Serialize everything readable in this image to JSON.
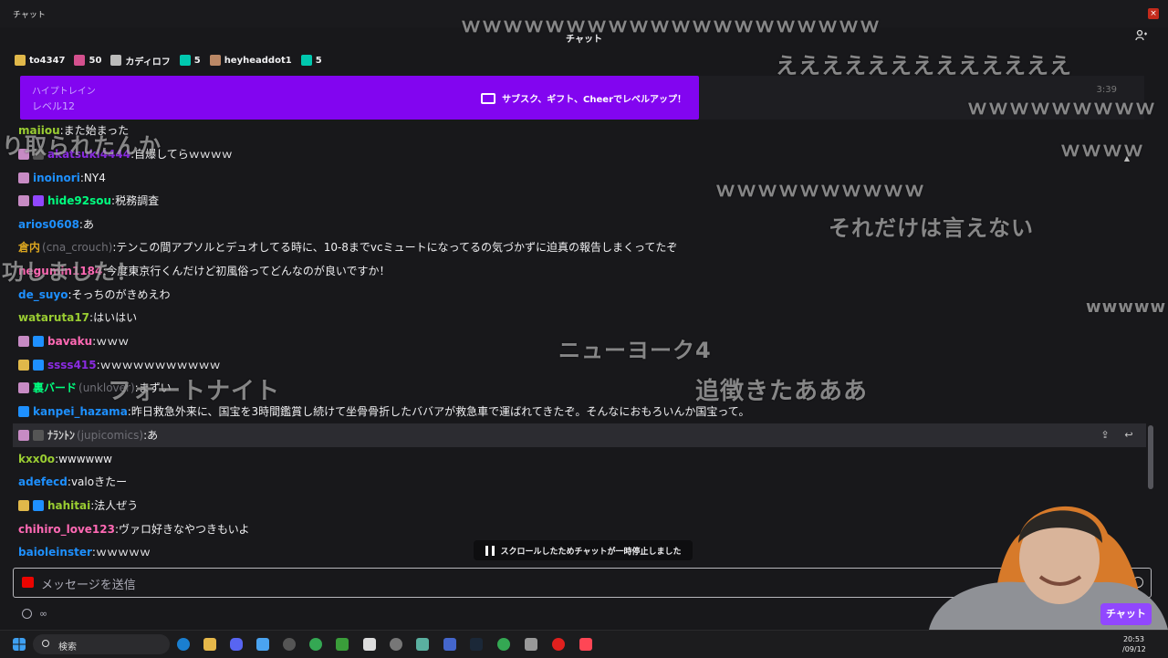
{
  "window": {
    "title": "チャット",
    "close": "×"
  },
  "header": {
    "title": "チャット"
  },
  "leaderboard": [
    {
      "name": "to4347",
      "color": "#e0b84a"
    },
    {
      "name": "50",
      "color": "#d4508e"
    },
    {
      "name": "カディロフ",
      "color": "#bbbbbb"
    },
    {
      "name": "5",
      "color": "#00c8af"
    },
    {
      "name": "heyheaddot1",
      "color": "#bb8866"
    },
    {
      "name": "5",
      "color": "#00c8af"
    }
  ],
  "hype_train": {
    "label": "ハイプトレイン",
    "level": "レベル12",
    "cta": "サブスク、ギフト、Cheerでレベルアップ！",
    "time": "3:39"
  },
  "messages": [
    {
      "user": "maiiou",
      "alias": "",
      "text": "また始まった",
      "color": "#9acd32",
      "badges": []
    },
    {
      "user": "akatsuki4444",
      "alias": "",
      "text": "自爆してらｗｗｗｗ",
      "color": "#8a2be2",
      "badges": [
        "#c78bc4",
        "#555555"
      ]
    },
    {
      "user": "inoinori",
      "alias": "",
      "text": "NY4",
      "color": "#1e90ff",
      "badges": [
        "#c78bc4"
      ]
    },
    {
      "user": "hide92sou",
      "alias": "",
      "text": "税務調査",
      "color": "#00ff7f",
      "badges": [
        "#c78bc4",
        "#9147ff"
      ]
    },
    {
      "user": "arios0608",
      "alias": "",
      "text": "あ",
      "color": "#1e90ff",
      "badges": []
    },
    {
      "user": "倉内",
      "alias": "(cna_crouch)",
      "text": "テンこの間アプソルとデュオしてる時に、10-8までvcミュートになってるの気づかずに迫真の報告しまくってたぞ",
      "color": "#daa520",
      "badges": []
    },
    {
      "user": "negumin1184",
      "alias": "",
      "text": "今度東京行くんだけど初風俗ってどんなのが良いですか！",
      "color": "#ff69b4",
      "badges": []
    },
    {
      "user": "de_suyo",
      "alias": "",
      "text": "そっちのがきめえわ",
      "color": "#1e90ff",
      "badges": []
    },
    {
      "user": "wataruta17",
      "alias": "",
      "text": "はいはい",
      "color": "#9acd32",
      "badges": []
    },
    {
      "user": "bavaku",
      "alias": "",
      "text": "ｗｗｗ",
      "color": "#ff69b4",
      "badges": [
        "#c78bc4",
        "#1e90ff"
      ]
    },
    {
      "user": "ssss415",
      "alias": "",
      "text": "ｗｗｗｗｗｗｗｗｗｗｗ",
      "color": "#8a2be2",
      "badges": [
        "#e0b84a",
        "#1e90ff"
      ]
    },
    {
      "user": "裏バード",
      "alias": "(unklover)",
      "text": "まずい",
      "color": "#00ff7f",
      "badges": [
        "#c78bc4"
      ]
    },
    {
      "user": "kanpei_hazama",
      "alias": "",
      "text": "昨日救急外来に、国宝を3時間鑑賞し続けて坐骨骨折したババアが救急車で運ばれてきたぞ。そんなにおもろいんか国宝って。",
      "color": "#1e90ff",
      "badges": [
        "#1e90ff"
      ]
    },
    {
      "user": "ﾅﾗﾝﾄﾝ",
      "alias": "(jupicomics)",
      "text": "あ",
      "color": "#cccccc",
      "badges": [
        "#c78bc4",
        "#555555"
      ]
    },
    {
      "user": "kxx0o",
      "alias": "",
      "text": "wwwwww",
      "color": "#9acd32",
      "badges": []
    },
    {
      "user": "adefecd",
      "alias": "",
      "text": "valoきたー",
      "color": "#1e90ff",
      "badges": []
    },
    {
      "user": "hahitai",
      "alias": "",
      "text": "法人ぜう",
      "color": "#9acd32",
      "badges": [
        "#e0b84a",
        "#1e90ff"
      ]
    },
    {
      "user": "chihiro_love123",
      "alias": "",
      "text": "ヴァロ好きなやつきもいよ",
      "color": "#ff69b4",
      "badges": []
    },
    {
      "user": "baioleinster",
      "alias": "",
      "text": "ｗｗｗｗｗ",
      "color": "#1e90ff",
      "badges": []
    }
  ],
  "pause_notice": "スクロールしたためチャットが一時停止しました",
  "input": {
    "placeholder": "メッセージを送信"
  },
  "points": "∞",
  "chat_button": "チャット",
  "overlay_comments": [
    "ｗｗｗｗｗｗｗｗｗｗｗｗｗｗｗｗｗｗｗｗ",
    "えええええええええええええ",
    "ｗｗｗｗｗｗｗｗｗ",
    "ｗｗｗｗ",
    "ｗｗｗｗｗｗｗｗｗｗ",
    "それだけは言えない",
    "wwwww",
    "ニューヨーク4",
    "フォートナイト",
    "追徴きたあああ",
    "り取られたんか",
    "功しました！"
  ],
  "taskbar": {
    "search": "検索",
    "time": "20:53",
    "date": "/09/12"
  }
}
